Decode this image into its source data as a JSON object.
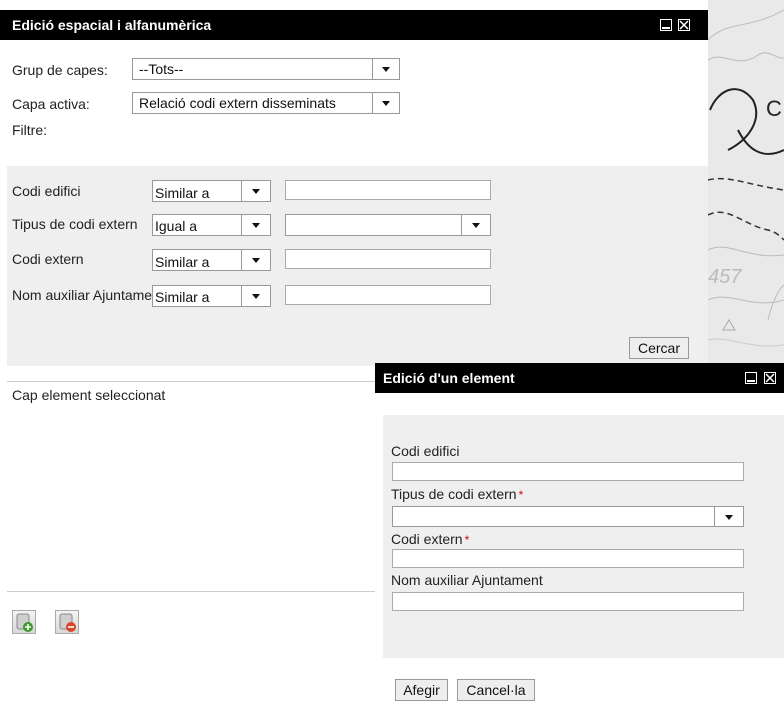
{
  "main_window": {
    "title": "Edició espacial i alfanumèrica",
    "layer_group_label": "Grup de capes:",
    "layer_group_value": "--Tots--",
    "active_layer_label": "Capa activa:",
    "active_layer_value": "Relació codi extern disseminats",
    "filter_label": "Filtre:",
    "filters": [
      {
        "label": "Codi edifici",
        "operator": "Similar a",
        "value": ""
      },
      {
        "label": "Tipus de codi extern",
        "operator": "Igual a",
        "value": ""
      },
      {
        "label": "Codi extern",
        "operator": "Similar a",
        "value": ""
      },
      {
        "label": "Nom auxiliar Ajuntament",
        "operator": "Similar a",
        "value": ""
      }
    ],
    "search_button": "Cercar",
    "selection_status": "Cap element seleccionat"
  },
  "edit_window": {
    "title": "Edició d'un element",
    "fields": [
      {
        "label": "Codi edifici",
        "required": false
      },
      {
        "label": "Tipus de codi extern",
        "required": true
      },
      {
        "label": "Codi extern",
        "required": true
      },
      {
        "label": "Nom auxiliar Ajuntament",
        "required": false
      }
    ],
    "required_mark": "*",
    "add_button": "Afegir",
    "cancel_button": "Cancel·la"
  },
  "map": {
    "label": "457",
    "partial_letter": "C"
  },
  "colors": {
    "titlebar": "#000000",
    "panel_gray": "#efefef",
    "required": "#dd0000",
    "add_icon": "#3a9a2a",
    "delete_icon": "#d9452b"
  }
}
